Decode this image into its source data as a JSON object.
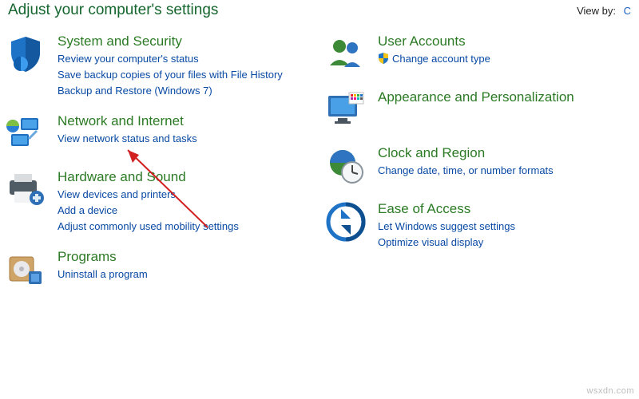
{
  "header": {
    "title": "Adjust your computer's settings",
    "view_by_label": "View by:",
    "view_by_value": "C"
  },
  "columns": {
    "left": [
      {
        "title": "System and Security",
        "links": [
          "Review your computer's status",
          "Save backup copies of your files with File History",
          "Backup and Restore (Windows 7)"
        ]
      },
      {
        "title": "Network and Internet",
        "links": [
          "View network status and tasks"
        ]
      },
      {
        "title": "Hardware and Sound",
        "links": [
          "View devices and printers",
          "Add a device",
          "Adjust commonly used mobility settings"
        ]
      },
      {
        "title": "Programs",
        "links": [
          "Uninstall a program"
        ]
      }
    ],
    "right": [
      {
        "title": "User Accounts",
        "links": [
          "Change account type"
        ],
        "shield_on_first": true
      },
      {
        "title": "Appearance and Personalization",
        "links": []
      },
      {
        "title": "Clock and Region",
        "links": [
          "Change date, time, or number formats"
        ]
      },
      {
        "title": "Ease of Access",
        "links": [
          "Let Windows suggest settings",
          "Optimize visual display"
        ]
      }
    ]
  },
  "watermark": "wsxdn.com"
}
